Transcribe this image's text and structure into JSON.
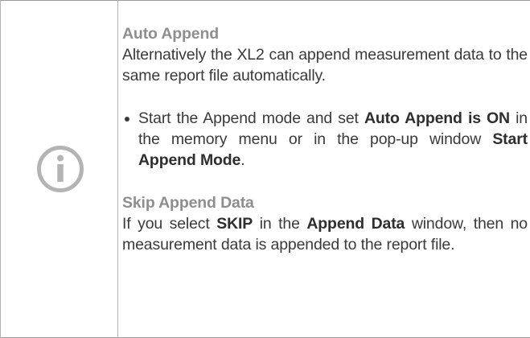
{
  "info_icon": "info-circle-icon",
  "colors": {
    "heading": "#8e8e8e",
    "body_text": "#3a3a3a",
    "icon": "#b4b4b4",
    "rules": "#9a9a9a"
  },
  "auto_append": {
    "heading": "Auto Append",
    "body": "Alternatively the XL2 can append measurement data to the same report file automatically."
  },
  "bullet": {
    "text_1": "Start the Append mode and set ",
    "bold_1": "Auto Append is ON",
    "text_2": " in the memory menu or in the pop-up window ",
    "bold_2": "Start Append Mode",
    "text_3": "."
  },
  "skip_append": {
    "heading": "Skip Append Data",
    "text_1": "If you select ",
    "bold_1": "SKIP",
    "text_2": " in the ",
    "bold_2": "Append Data",
    "text_3": " window, then no measurement data is appended to the report file."
  }
}
